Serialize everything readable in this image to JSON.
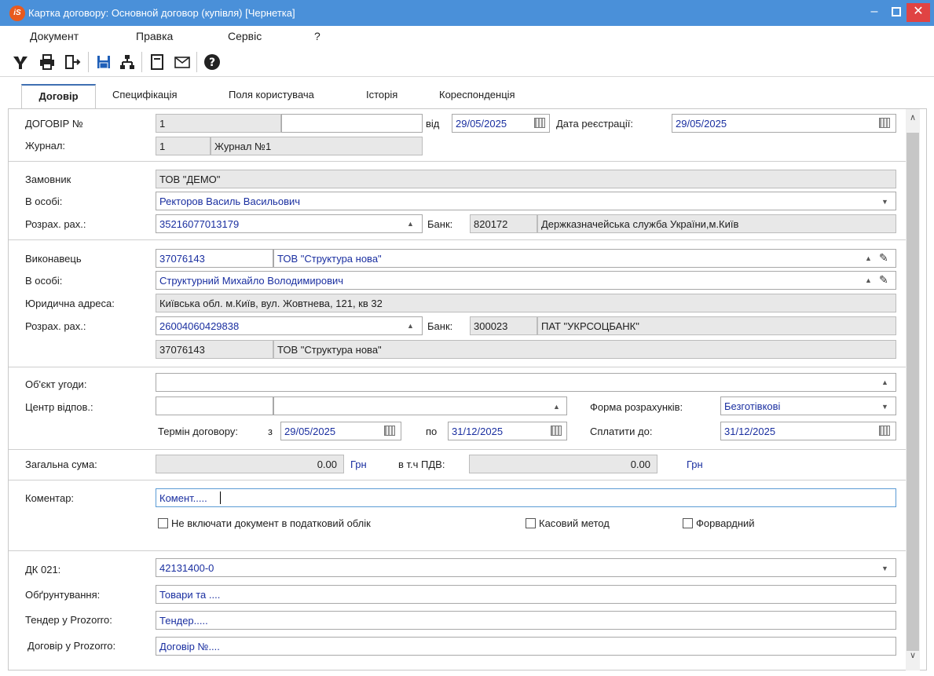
{
  "window": {
    "title": "Картка договору:  Основной договор (купівля) [Чернетка]",
    "logo_text": "iS"
  },
  "menu": [
    "Документ",
    "Правка",
    "Сервіс",
    "?"
  ],
  "toolbar_icons": [
    "filter-icon",
    "print-icon",
    "exit-icon",
    "save-icon",
    "structure-icon",
    "document-icon",
    "mail-icon",
    "help-icon"
  ],
  "tabs": [
    "Договір",
    "Специфікація",
    "Поля користувача",
    "Історія",
    "Кореспонденція"
  ],
  "contract": {
    "label_number": "ДОГОВІР №",
    "number": "1",
    "suffix": "",
    "label_from": "від",
    "date": "29/05/2025",
    "label_reg_date": "Дата реєстрації:",
    "reg_date": "29/05/2025",
    "label_journal": "Журнал:",
    "journal_num": "1",
    "journal_name": "Журнал №1"
  },
  "customer": {
    "label": "Замовник",
    "name": "ТОВ \"ДЕМО\"",
    "label_person": "В особі:",
    "person": "Ректоров Василь Васильович",
    "label_account": "Розрах. рах.:",
    "account": "35216077013179",
    "label_bank": "Банк:",
    "bank_code": "820172",
    "bank_name": "Держказначейська служба України,м.Київ"
  },
  "executor": {
    "label": "Виконавець",
    "code": "37076143",
    "name": "ТОВ \"Структура нова\"",
    "label_person": "В особі:",
    "person": "Структурний Михайло Володимирович",
    "label_address": "Юридична адреса:",
    "address": "Київська обл. м.Київ, вул. Жовтнева, 121, кв 32",
    "label_account": "Розрах. рах.:",
    "account": "26004060429838",
    "label_bank": "Банк:",
    "bank_code": "300023",
    "bank_name": "ПАТ \"УКРСОЦБАНК\"",
    "owner_code": "37076143",
    "owner_name": "ТОВ \"Структура нова\""
  },
  "terms": {
    "label_object": "Об'єкт угоди:",
    "object": "",
    "label_center": "Центр відпов.:",
    "center_code": "",
    "center_name": "",
    "label_payment_form": "Форма розрахунків:",
    "payment_form": "Безготівкові",
    "label_term": "Термін договору:",
    "label_from": "з",
    "term_from": "29/05/2025",
    "label_to": "по",
    "term_to": "31/12/2025",
    "label_pay_until": "Сплатити до:",
    "pay_until": "31/12/2025"
  },
  "totals": {
    "label_total": "Загальна сума:",
    "total": "0.00",
    "currency": "Грн",
    "label_vat": "в т.ч ПДВ:",
    "vat": "0.00",
    "vat_currency": "Грн"
  },
  "comment": {
    "label": "Коментар:",
    "value": "Комент.....",
    "chk_tax": "Не включати документ в податковий облік",
    "chk_cash": "Касовий метод",
    "chk_forward": "Форвардний"
  },
  "prozorro": {
    "label_dk": "ДК 021:",
    "dk": "42131400-0",
    "label_reason": "Обґрунтування:",
    "reason": "Товари та ....",
    "label_tender": "Тендер у Prozorro:",
    "tender": "Тендер.....",
    "label_contract": "Договір у Prozorro:",
    "contract": "Договір №...."
  }
}
